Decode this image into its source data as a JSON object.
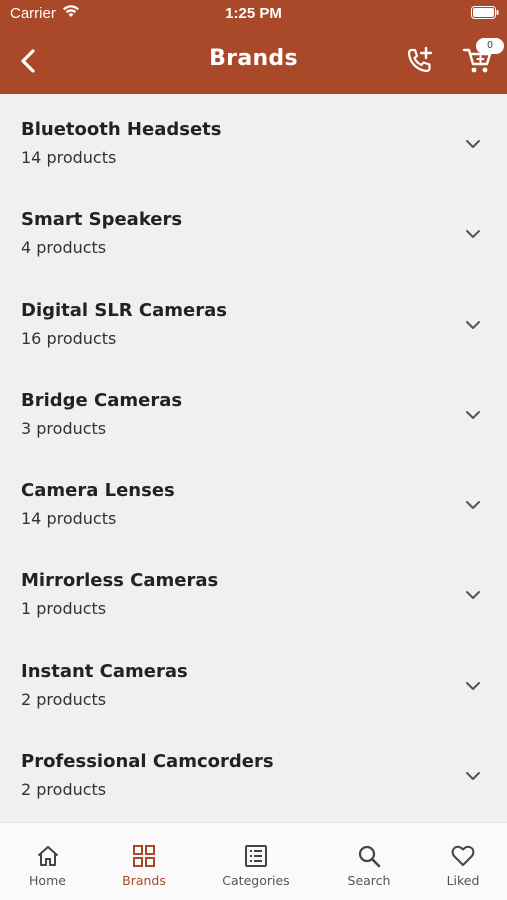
{
  "status_bar": {
    "carrier": "Carrier",
    "time": "1:25 PM"
  },
  "header": {
    "title": "Brands",
    "cart_count": "0",
    "icons": [
      "back-icon",
      "phone-add-icon",
      "cart-icon"
    ],
    "color": "#a9492a"
  },
  "brands": {
    "items": [
      {
        "name": "Bluetooth Headsets",
        "count": "14 products"
      },
      {
        "name": "Smart Speakers",
        "count": "4 products"
      },
      {
        "name": "Digital SLR Cameras",
        "count": "16 products"
      },
      {
        "name": "Bridge Cameras",
        "count": "3 products"
      },
      {
        "name": "Camera Lenses",
        "count": "14 products"
      },
      {
        "name": "Mirrorless Cameras",
        "count": "1 products"
      },
      {
        "name": "Instant Cameras",
        "count": "2 products"
      },
      {
        "name": "Professional Camcorders",
        "count": "2 products"
      }
    ]
  },
  "tabbar": {
    "active": "Brands",
    "active_color": "#a9492a",
    "tabs": [
      {
        "label": "Home",
        "icon": "home-icon"
      },
      {
        "label": "Brands",
        "icon": "grid-icon"
      },
      {
        "label": "Categories",
        "icon": "list-icon"
      },
      {
        "label": "Search",
        "icon": "search-icon"
      },
      {
        "label": "Liked",
        "icon": "heart-icon"
      }
    ]
  }
}
